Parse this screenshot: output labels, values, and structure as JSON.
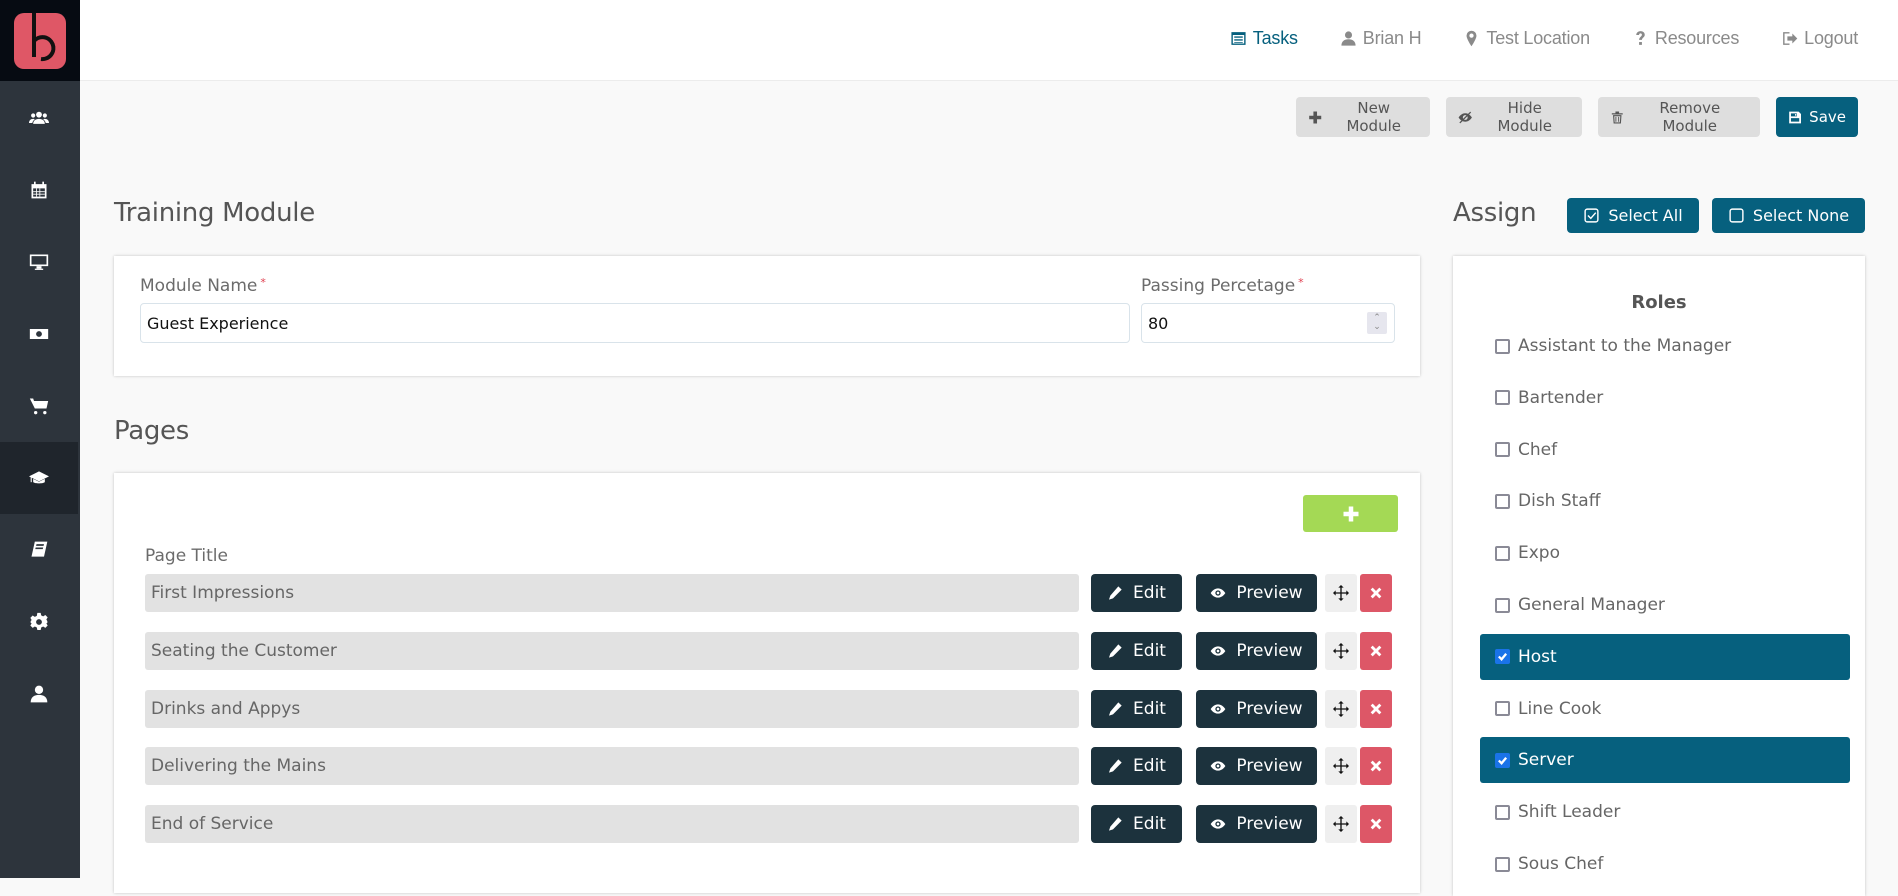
{
  "brand": {
    "logo_color": "#df5766"
  },
  "sidebar": {
    "items": [
      {
        "icon": "users-icon",
        "active": false
      },
      {
        "icon": "calendar-icon",
        "active": false
      },
      {
        "icon": "desktop-icon",
        "active": false
      },
      {
        "icon": "money-icon",
        "active": false
      },
      {
        "icon": "cart-icon",
        "active": false
      },
      {
        "icon": "graduation-cap-icon",
        "active": true
      },
      {
        "icon": "book-icon",
        "active": false
      },
      {
        "icon": "gear-icon",
        "active": false
      },
      {
        "icon": "user-icon",
        "active": false
      }
    ]
  },
  "topnav": {
    "tasks": "Tasks",
    "user": "Brian H",
    "location": "Test Location",
    "resources": "Resources",
    "logout": "Logout"
  },
  "toolbar": {
    "new_module": "New Module",
    "hide_module": "Hide Module",
    "remove_module": "Remove Module",
    "save": "Save"
  },
  "module": {
    "section_title": "Training Module",
    "name_label": "Module Name",
    "name_value": "Guest Experience",
    "passing_label": "Passing Percetage",
    "passing_value": "80",
    "required_marker": "*"
  },
  "pages": {
    "section_title": "Pages",
    "column_label": "Page Title",
    "edit_label": "Edit",
    "preview_label": "Preview",
    "items": [
      {
        "title": "First Impressions"
      },
      {
        "title": "Seating the Customer"
      },
      {
        "title": "Drinks and Appys"
      },
      {
        "title": "Delivering the Mains"
      },
      {
        "title": "End of Service"
      }
    ]
  },
  "assign": {
    "section_title": "Assign",
    "select_all": "Select All",
    "select_none": "Select None",
    "roles_title": "Roles",
    "roles": [
      {
        "label": "Assistant to the Manager",
        "checked": false
      },
      {
        "label": "Bartender",
        "checked": false
      },
      {
        "label": "Chef",
        "checked": false
      },
      {
        "label": "Dish Staff",
        "checked": false
      },
      {
        "label": "Expo",
        "checked": false
      },
      {
        "label": "General Manager",
        "checked": false
      },
      {
        "label": "Host",
        "checked": true
      },
      {
        "label": "Line Cook",
        "checked": false
      },
      {
        "label": "Server",
        "checked": true
      },
      {
        "label": "Shift Leader",
        "checked": false
      },
      {
        "label": "Sous Chef",
        "checked": false
      }
    ]
  },
  "colors": {
    "accent": "#06607e",
    "dark_button": "#1c323d",
    "danger": "#dd5767",
    "success": "#a4d955",
    "sidebar_bg": "#2d343c"
  }
}
